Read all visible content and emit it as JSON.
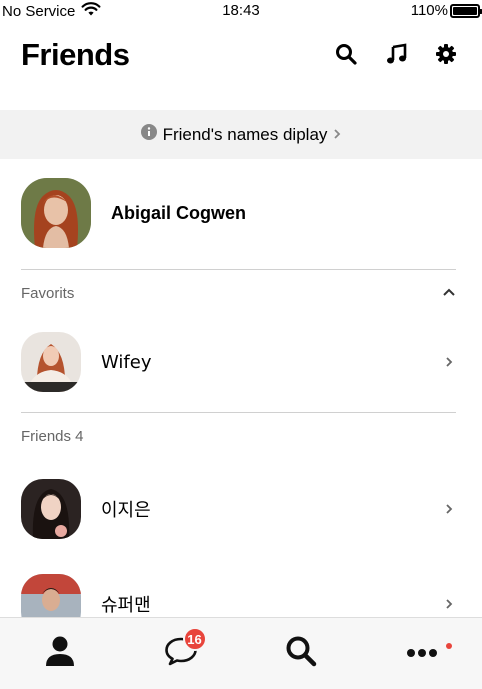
{
  "status_bar": {
    "carrier": "No Service",
    "time": "18:43",
    "battery": "110%"
  },
  "header": {
    "title": "Friends",
    "icons": [
      "search-icon",
      "music-note-icon",
      "gear-icon"
    ]
  },
  "banner": {
    "text": "Friend's names diplay",
    "icon": "info-icon"
  },
  "profile": {
    "name": "Abigail Cogwen"
  },
  "favorites": {
    "label": "Favorits",
    "items": [
      {
        "name": "Wifey"
      }
    ]
  },
  "friends": {
    "label": "Friends 4",
    "items": [
      {
        "name": "이지은"
      },
      {
        "name": "슈퍼맨"
      }
    ]
  },
  "tab_bar": {
    "tabs": [
      "person-icon",
      "chat-icon",
      "search-icon",
      "more-icon"
    ],
    "chat_badge": "16"
  },
  "colors": {
    "badge": "#e8453c",
    "banner_bg": "#f2f2f2",
    "tabbar_bg": "#f7f7f7"
  }
}
